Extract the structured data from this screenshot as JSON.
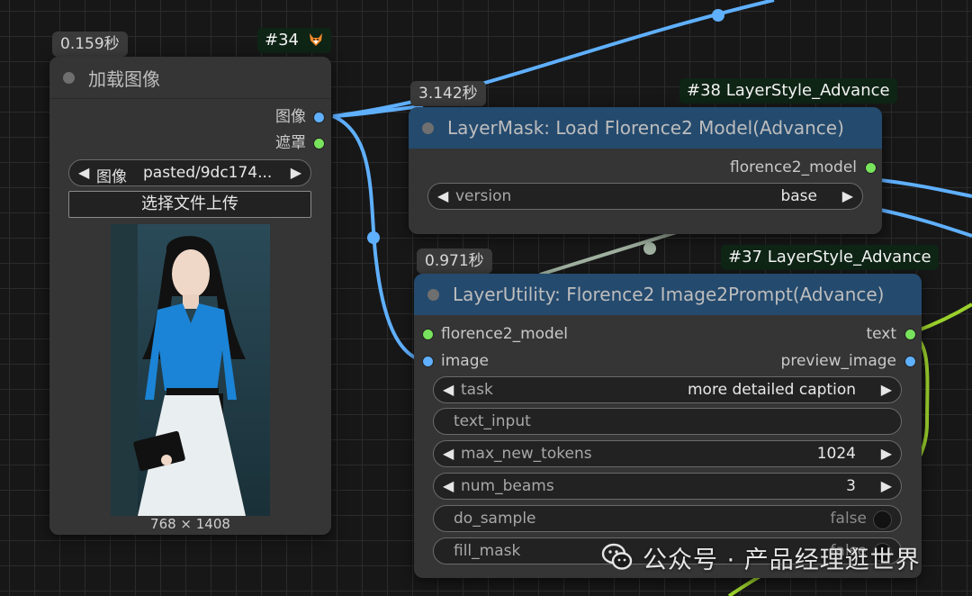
{
  "colors": {
    "canvas_bg": "#171717",
    "node_bg": "#353535",
    "header_blue": "#244a6e",
    "id_badge_bg": "#0e2415",
    "link_blue": "#5fb0ff",
    "link_green": "#78e35c",
    "link_olive": "#9bd02c",
    "link_gray": "#a0b0a0"
  },
  "node34": {
    "time": "0.159秒",
    "id": "#34",
    "id_icon": "fox-icon",
    "title": "加载图像",
    "outputs": [
      "图像",
      "遮罩"
    ],
    "image_widget": {
      "label": "图像",
      "value": "pasted/9dc174..."
    },
    "upload_label": "选择文件上传",
    "preview_icon": "portrait-photo",
    "dimensions": "768 × 1408"
  },
  "node38": {
    "time": "3.142秒",
    "id": "#38 LayerStyle_Advance",
    "title": "LayerMask: Load Florence2 Model(Advance)",
    "output": "florence2_model",
    "version_widget": {
      "label": "version",
      "value": "base"
    }
  },
  "node37": {
    "time": "0.971秒",
    "id": "#37 LayerStyle_Advance",
    "title": "LayerUtility: Florence2 Image2Prompt(Advance)",
    "inputs": [
      "florence2_model",
      "image"
    ],
    "outputs": [
      "text",
      "preview_image"
    ],
    "widgets": {
      "task": {
        "label": "task",
        "value": "more detailed caption"
      },
      "text_input": {
        "label": "text_input"
      },
      "max_new_tokens": {
        "label": "max_new_tokens",
        "value": "1024"
      },
      "num_beams": {
        "label": "num_beams",
        "value": "3"
      },
      "do_sample": {
        "label": "do_sample",
        "value": "false"
      },
      "fill_mask": {
        "label": "fill_mask",
        "value": "false"
      }
    }
  },
  "watermark": {
    "icon": "wechat-icon",
    "text": "公众号 · 产品经理逛世界"
  }
}
